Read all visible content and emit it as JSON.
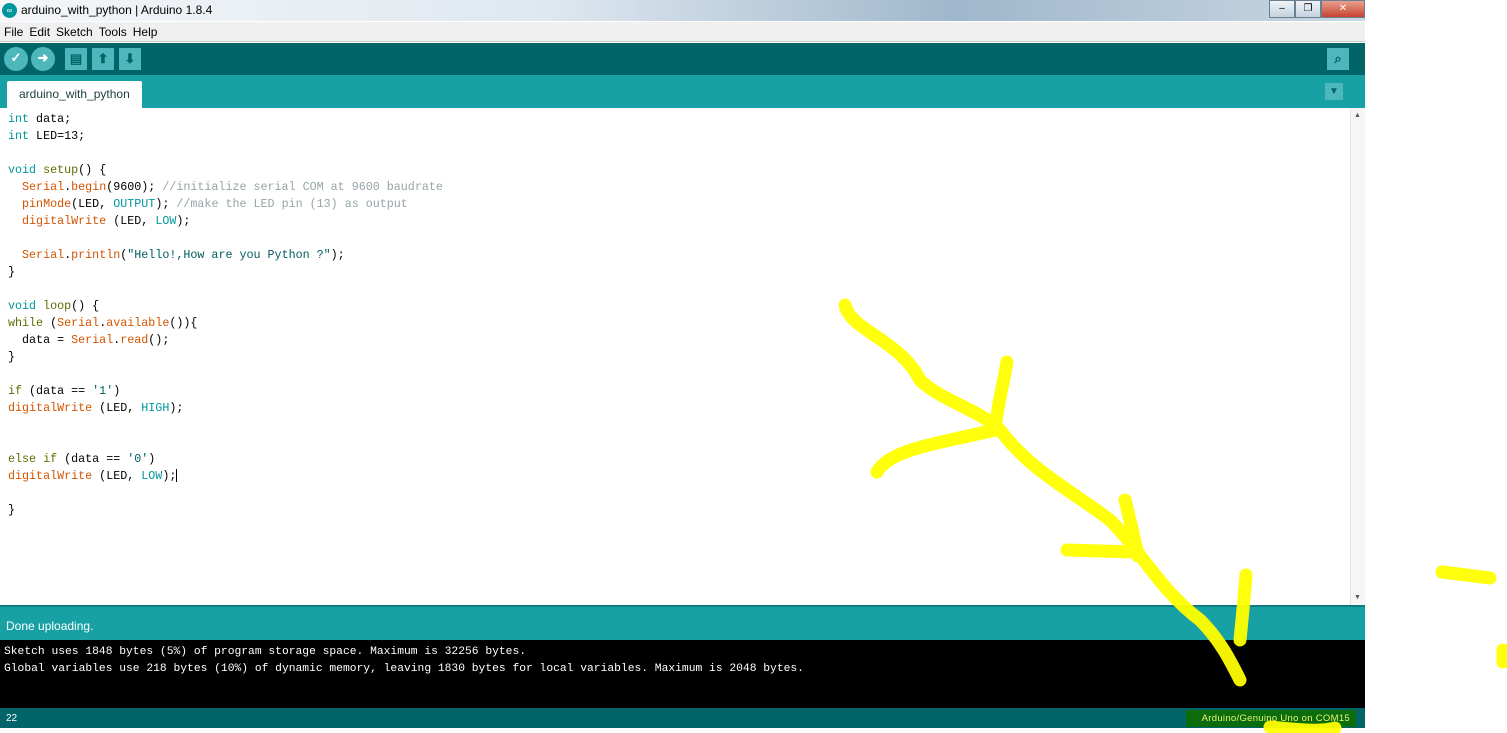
{
  "window": {
    "title": "arduino_with_python | Arduino 1.8.4",
    "logo_icon": "arduino-logo-icon",
    "controls": [
      "minimize",
      "maximize",
      "close"
    ]
  },
  "menu": [
    "File",
    "Edit",
    "Sketch",
    "Tools",
    "Help"
  ],
  "toolbar": {
    "buttons": [
      {
        "name": "verify",
        "icon": "check-icon",
        "glyph": "✓"
      },
      {
        "name": "upload",
        "icon": "arrow-right-icon",
        "glyph": "➜"
      },
      {
        "name": "new",
        "icon": "document-icon",
        "glyph": "▤"
      },
      {
        "name": "open",
        "icon": "arrow-up-icon",
        "glyph": "⬆"
      },
      {
        "name": "save",
        "icon": "arrow-down-icon",
        "glyph": "⬇"
      }
    ],
    "serial_monitor": {
      "icon": "magnifier-icon",
      "glyph": "⌕"
    }
  },
  "tabs": [
    {
      "label": "arduino_with_python",
      "active": true
    }
  ],
  "tab_menu_glyph": "▼",
  "code": [
    [
      [
        "int",
        "k"
      ],
      [
        " data;",
        ""
      ]
    ],
    [
      [
        "int",
        "k"
      ],
      [
        " LED=13;",
        ""
      ]
    ],
    [],
    [
      [
        "void",
        "k"
      ],
      [
        " ",
        ""
      ],
      [
        "setup",
        "f"
      ],
      [
        "() {",
        ""
      ]
    ],
    [
      [
        "  ",
        ""
      ],
      [
        "Serial",
        "o"
      ],
      [
        ".",
        ""
      ],
      [
        "begin",
        "o"
      ],
      [
        "(9600); ",
        ""
      ],
      [
        "//initialize serial COM at 9600 baudrate",
        "cm"
      ]
    ],
    [
      [
        "  ",
        ""
      ],
      [
        "pinMode",
        "o"
      ],
      [
        "(LED, ",
        ""
      ],
      [
        "OUTPUT",
        "c"
      ],
      [
        "); ",
        ""
      ],
      [
        "//make the LED pin (13) as output",
        "cm"
      ]
    ],
    [
      [
        "  ",
        ""
      ],
      [
        "digitalWrite",
        "o"
      ],
      [
        " (LED, ",
        ""
      ],
      [
        "LOW",
        "c"
      ],
      [
        ");",
        ""
      ]
    ],
    [],
    [
      [
        "  ",
        ""
      ],
      [
        "Serial",
        "o"
      ],
      [
        ".",
        ""
      ],
      [
        "println",
        "o"
      ],
      [
        "(",
        ""
      ],
      [
        "\"Hello!,How are you Python ?\"",
        "s"
      ],
      [
        ");",
        ""
      ]
    ],
    [
      [
        "}",
        ""
      ]
    ],
    [],
    [
      [
        "void",
        "k"
      ],
      [
        " ",
        ""
      ],
      [
        "loop",
        "f"
      ],
      [
        "() {",
        ""
      ]
    ],
    [
      [
        "while",
        "f"
      ],
      [
        " (",
        ""
      ],
      [
        "Serial",
        "o"
      ],
      [
        ".",
        ""
      ],
      [
        "available",
        "o"
      ],
      [
        "()){",
        ""
      ]
    ],
    [
      [
        "  data = ",
        ""
      ],
      [
        "Serial",
        "o"
      ],
      [
        ".",
        ""
      ],
      [
        "read",
        "o"
      ],
      [
        "();",
        ""
      ]
    ],
    [
      [
        "}",
        ""
      ]
    ],
    [],
    [
      [
        "if",
        "f"
      ],
      [
        " (data == ",
        ""
      ],
      [
        "'1'",
        "s"
      ],
      [
        ")",
        ""
      ]
    ],
    [
      [
        "digitalWrite",
        "o"
      ],
      [
        " (LED, ",
        ""
      ],
      [
        "HIGH",
        "c"
      ],
      [
        ");",
        ""
      ]
    ],
    [],
    [],
    [
      [
        "else",
        "f"
      ],
      [
        " ",
        ""
      ],
      [
        "if",
        "f"
      ],
      [
        " (data == ",
        ""
      ],
      [
        "'0'",
        "s"
      ],
      [
        ")",
        ""
      ]
    ],
    [
      [
        "digitalWrite",
        "o"
      ],
      [
        " (LED, ",
        ""
      ],
      [
        "LOW",
        "c"
      ],
      [
        ");",
        ""
      ]
    ],
    [],
    [
      [
        "}",
        ""
      ]
    ]
  ],
  "status": {
    "message": "Done uploading."
  },
  "console": [
    "Sketch uses 1848 bytes (5%) of program storage space. Maximum is 32256 bytes.",
    "Global variables use 218 bytes (10%) of dynamic memory, leaving 1830 bytes for local variables. Maximum is 2048 bytes."
  ],
  "footer": {
    "line_number": "22",
    "board": "Arduino/Genuino Uno on COM15"
  },
  "colors": {
    "toolbar": "#006468",
    "tabbar": "#17a1a5",
    "annotation": "#ffff00"
  }
}
